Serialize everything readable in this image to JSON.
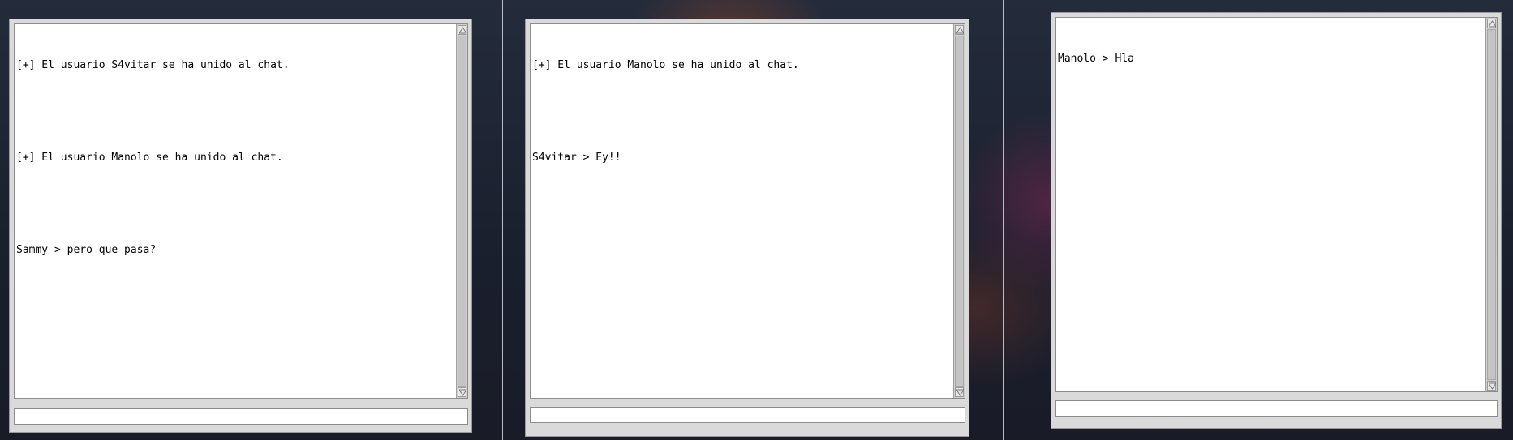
{
  "windows": [
    {
      "messages": [
        "[+] El usuario S4vitar se ha unido al chat.",
        "",
        "[+] El usuario Manolo se ha unido al chat.",
        "",
        "Sammy > pero que pasa?"
      ],
      "input_value": ""
    },
    {
      "messages": [
        "[+] El usuario Manolo se ha unido al chat.",
        "",
        "S4vitar > Ey!!"
      ],
      "input_value": ""
    },
    {
      "messages": [
        "Manolo > Hla"
      ],
      "input_value": ""
    }
  ],
  "icons": {
    "scroll_up": "triangle-up-icon",
    "scroll_down": "triangle-down-icon"
  }
}
